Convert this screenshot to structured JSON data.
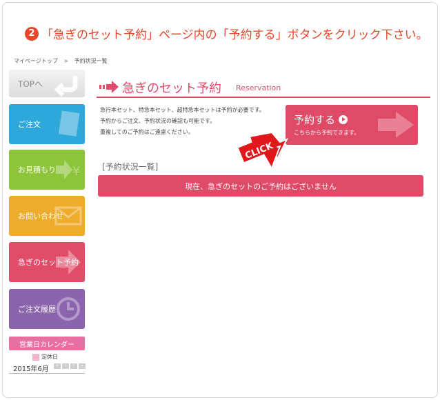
{
  "step": {
    "number": "2",
    "text": "「急ぎのセット予約」ページ内の「予約する」ボタンをクリック下さい。"
  },
  "breadcrumb": {
    "home": "マイページトップ",
    "separator": ">",
    "current": "予約状況一覧"
  },
  "sidebar": {
    "items": [
      {
        "label": "TOPへ"
      },
      {
        "label": "ご注文"
      },
      {
        "label": "お見積もり"
      },
      {
        "label": "お問い合わせ"
      },
      {
        "label": "急ぎのセット予約"
      },
      {
        "label": "ご注文履歴"
      }
    ],
    "calendar_button": "営業日カレンダー",
    "holiday_legend": "定休日",
    "month": "2015年6月"
  },
  "main": {
    "title": "急ぎのセット予約",
    "subtitle": "Reservation",
    "description": [
      "急行本セット、特急本セット、超特急本セットは予約が必要です。",
      "予約からご注文、予約状況の確認も可能です。",
      "重複してのご予約はご遠慮ください。"
    ],
    "reserve_button": {
      "label": "予約する",
      "sub": "こちらから予約できます。"
    },
    "click_tag": "CLICK",
    "section_title": "[予約状況一覧]",
    "status_message": "現在、急ぎのセットのご予約はございません"
  },
  "colors": {
    "accent": "#e14c68",
    "step": "#e8462a",
    "order": "#2ea7db",
    "estimate": "#8cc43a",
    "contact": "#efab2c",
    "history": "#8a64ad",
    "calendar": "#e86fa1"
  }
}
